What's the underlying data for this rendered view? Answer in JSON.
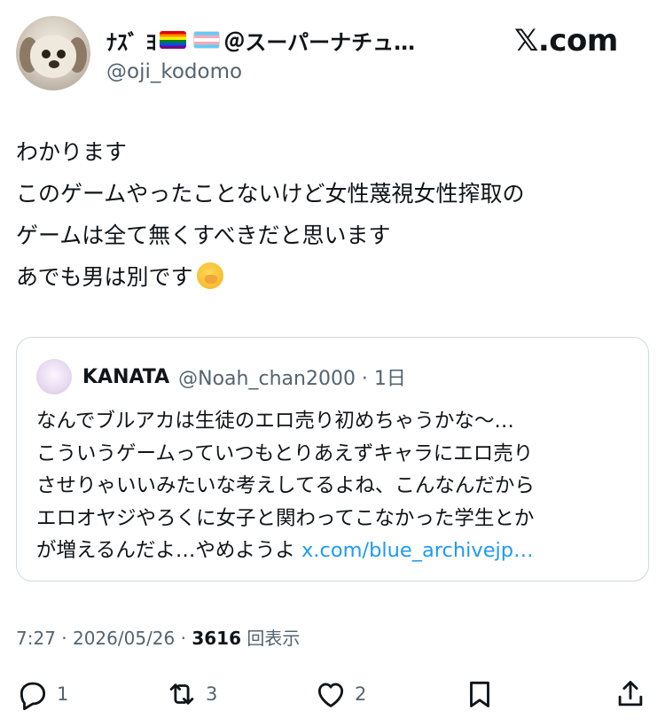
{
  "author": {
    "display_name_prefix": "ﾅｽﾞ ﾖ",
    "display_name_suffix": "＠スーパーナチュ…",
    "handle": "@oji_kodomo"
  },
  "brand": {
    "logo_text": "𝕏.com"
  },
  "tweet": {
    "lines": [
      "わかります",
      "このゲームやったことないけど女性蔑視女性搾取の",
      "ゲームは全て無くすべきだと思います",
      "あでも男は別です"
    ],
    "emoji_name": "face-with-hand-over-mouth"
  },
  "quote": {
    "name": "KANATA",
    "handle_time": "@Noah_chan2000 · 1日",
    "lines": [
      "なんでブルアカは生徒のエロ売り初めちゃうかな〜…",
      "こういうゲームっていつもとりあえずキャラにエロ売り",
      "させりゃいいみたいな考えしてるよね、こんなんだから",
      "エロオヤジやろくに女子と関わってこなかった学生とか"
    ],
    "last_line_text": "が増えるんだよ…やめようよ ",
    "link_text": "x.com/blue_archivejp…"
  },
  "meta": {
    "time_date": "7:27 · 2026/05/26 · ",
    "views_count": "3616",
    "views_label": " 回表示"
  },
  "actions": {
    "replies": "1",
    "retweets": "3",
    "likes": "2"
  },
  "colors": {
    "link": "#1d9bf0",
    "secondary_text": "#536471",
    "border": "#cfd9de"
  }
}
